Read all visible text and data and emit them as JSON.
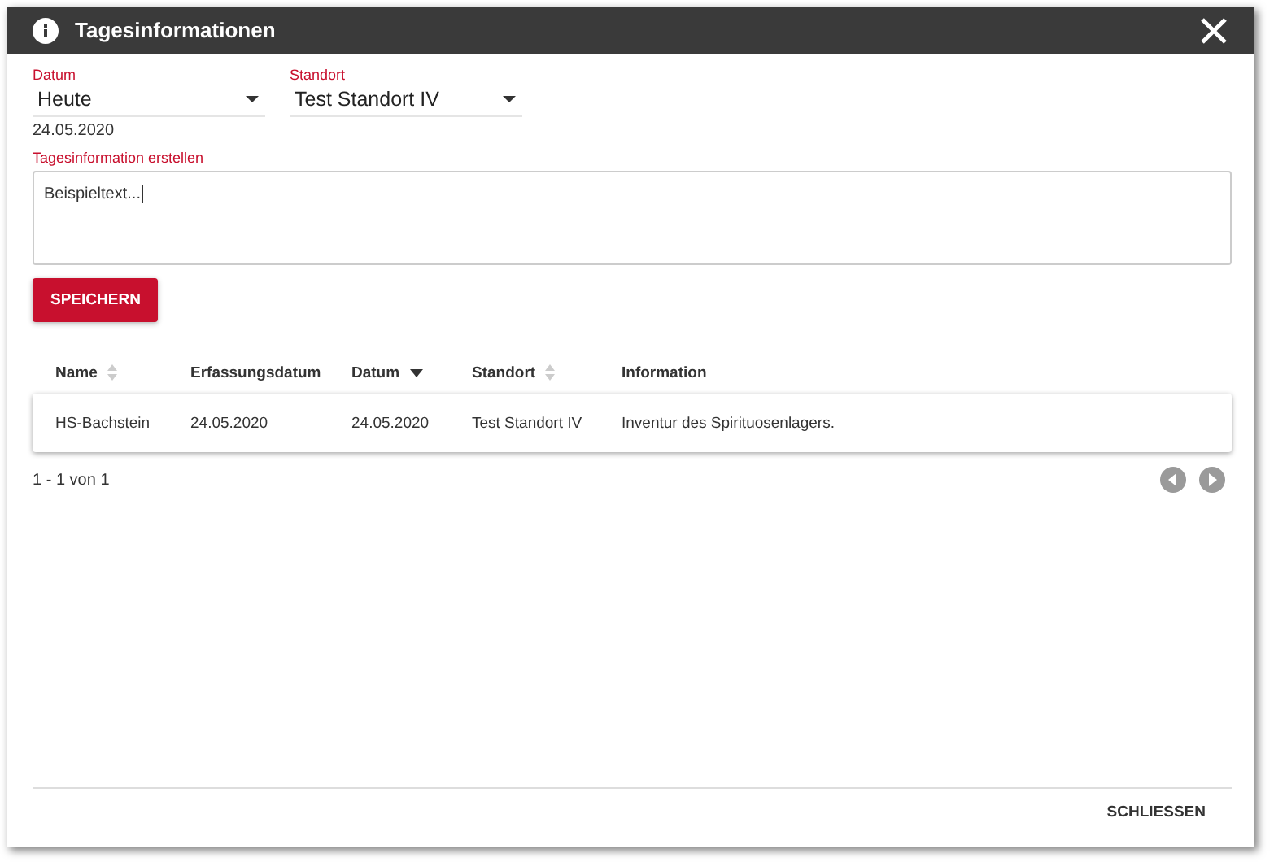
{
  "dialog": {
    "title": "Tagesinformationen"
  },
  "filters": [
    {
      "label": "Datum",
      "value": "Heute",
      "note": "24.05.2020"
    },
    {
      "label": "Standort",
      "value": "Test Standort IV"
    }
  ],
  "entry": {
    "label": "Tagesinformation erstellen",
    "value": "Beispieltext...",
    "focused": true
  },
  "save_button": "SPEICHERN",
  "table": {
    "columns": [
      {
        "label": "Name",
        "kind": "sortable"
      },
      {
        "label": "Erfassungsdatum",
        "kind": "plain"
      },
      {
        "label": "Datum",
        "kind": "descending"
      },
      {
        "label": "Standort",
        "kind": "sortable"
      },
      {
        "label": "Information",
        "kind": "plain"
      }
    ],
    "rows": [
      [
        "HS-Bachstein",
        "24.05.2020",
        "24.05.2020",
        "Test Standort IV",
        "Inventur des Spirituosenlagers."
      ]
    ]
  },
  "pagination": {
    "range": "1 - 1 von 1"
  },
  "close_button": "SCHLIESSEN"
}
